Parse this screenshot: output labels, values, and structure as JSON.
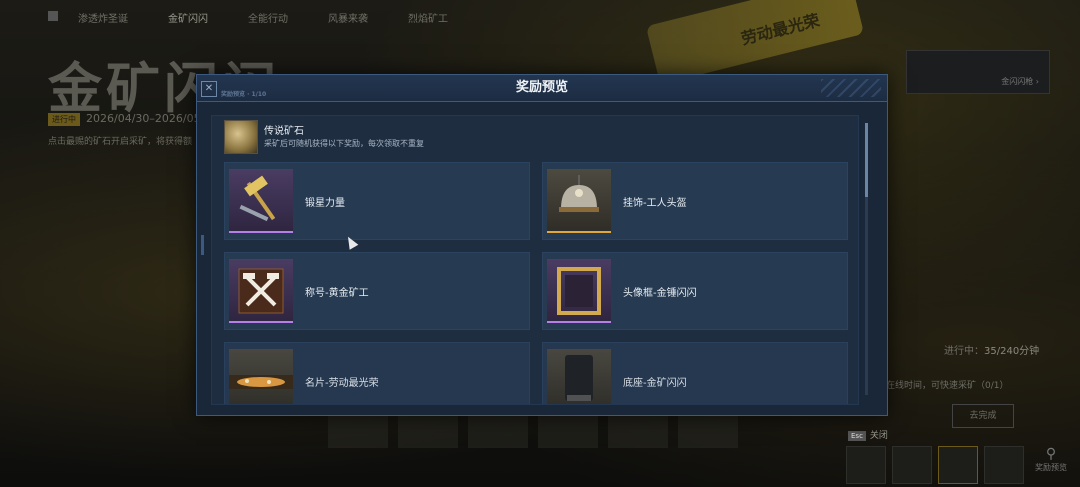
{
  "background": {
    "nav": [
      "渗透炸圣诞",
      "金矿闪闪",
      "全能行动",
      "风暴来袭",
      "烈焰矿工"
    ],
    "title": "金矿闪闪",
    "date_tag": "进行中",
    "date": "2026/04/30–2026/05",
    "desc": "点击最赐的矿石开启采矿，将获得额",
    "machine_text": "劳动最光荣",
    "weapon_label": "金闪闪枪 ›",
    "progress_label": "进行中：",
    "progress_value": "35/240分钟",
    "hint": "在线时间，可快速采矿（0/1）",
    "button": "去完成",
    "esc_key": "Esc",
    "esc_label": "关闭",
    "search_label": "奖励预览"
  },
  "modal": {
    "title": "奖励预览",
    "corner_label": "奖励预览 · 1/10",
    "source": {
      "title": "传说矿石",
      "desc": "采矿后可随机获得以下奖励，每次领取不重复"
    },
    "rewards": [
      {
        "name": "锻星力量",
        "rarity": "purple",
        "icon": "hammer-icon"
      },
      {
        "name": "挂饰-工人头盔",
        "rarity": "gold",
        "icon": "helmet-icon"
      },
      {
        "name": "称号-黄金矿工",
        "rarity": "purple",
        "icon": "crossed-tools-icon"
      },
      {
        "name": "头像框-金锤闪闪",
        "rarity": "purple",
        "icon": "frame-icon"
      },
      {
        "name": "名片-劳动最光荣",
        "rarity": "gold",
        "icon": "card-icon"
      },
      {
        "name": "底座-金矿闪闪",
        "rarity": "gold",
        "icon": "pedestal-icon"
      }
    ]
  },
  "colors": {
    "purple": "#b57ee8",
    "gold": "#e0a83a",
    "accent": "#3c5a80"
  }
}
